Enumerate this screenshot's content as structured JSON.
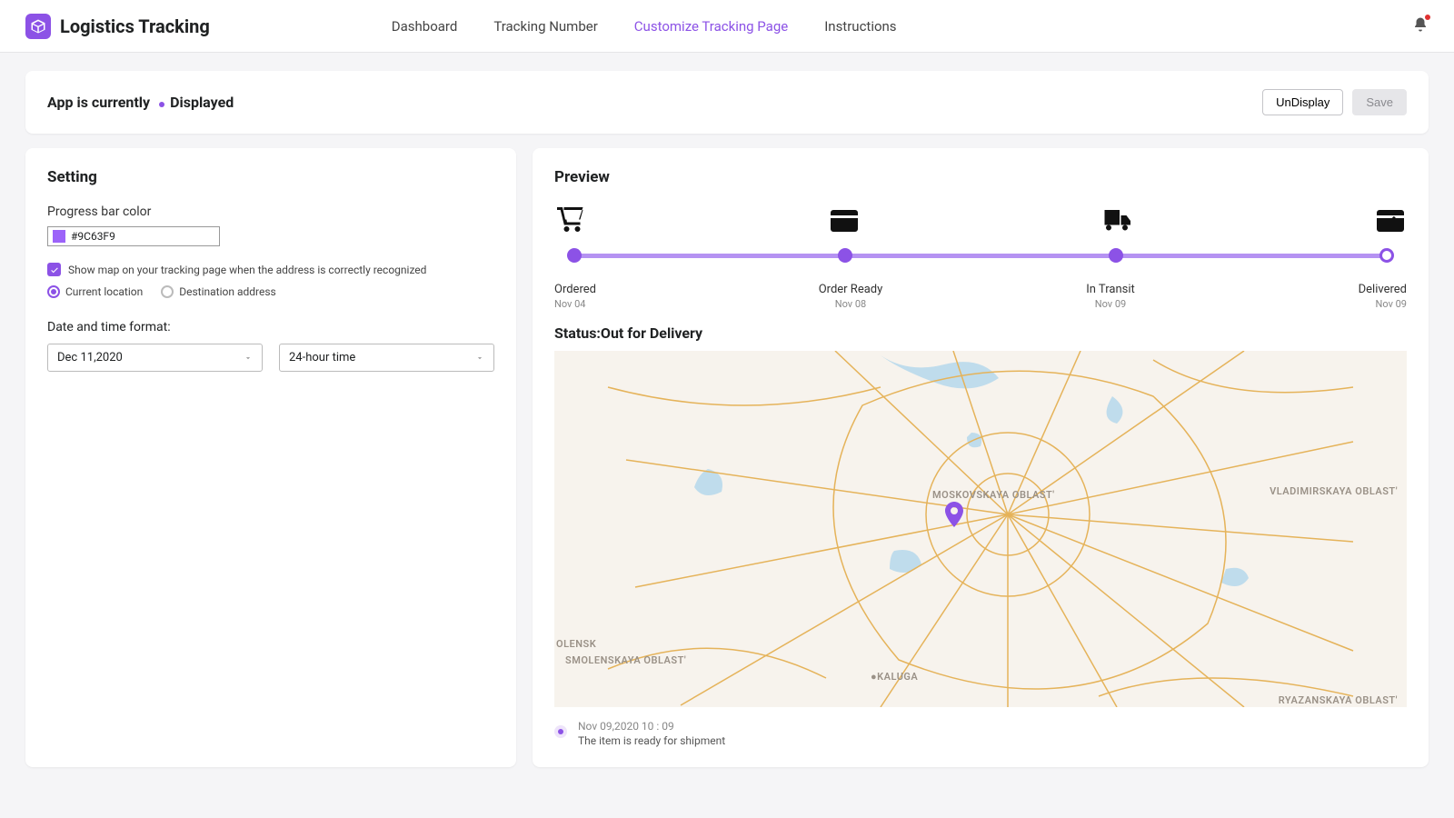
{
  "header": {
    "app_title": "Logistics Tracking",
    "nav": [
      {
        "label": "Dashboard",
        "active": false
      },
      {
        "label": "Tracking Number",
        "active": false
      },
      {
        "label": "Customize Tracking Page",
        "active": true
      },
      {
        "label": "Instructions",
        "active": false
      }
    ]
  },
  "status_bar": {
    "prefix": "App is currently",
    "value": "Displayed",
    "undisplay_btn": "UnDisplay",
    "save_btn": "Save"
  },
  "settings": {
    "title": "Setting",
    "progress_color_label": "Progress bar color",
    "progress_color_value": "#9C63F9",
    "checkbox_label": "Show map on your tracking page when the address is correctly recognized",
    "radio_current": "Current location",
    "radio_destination": "Destination address",
    "date_format_label": "Date and time format:",
    "date_select": "Dec 11,2020",
    "time_select": "24-hour time"
  },
  "preview": {
    "title": "Preview",
    "steps": [
      {
        "name": "Ordered",
        "date": "Nov 04"
      },
      {
        "name": "Order Ready",
        "date": "Nov 08"
      },
      {
        "name": "In Transit",
        "date": "Nov 09"
      },
      {
        "name": "Delivered",
        "date": "Nov 09"
      }
    ],
    "status_heading": "Status:Out for Delivery",
    "map_labels": {
      "moskovskaya": "MOSKOVSKAYA OBLAST'",
      "vladimirskaya": "VLADIMIRSKAYA OBLAST'",
      "olensk": "OLENSK",
      "smolenskaya": "SMOLENSKAYA OBLAST'",
      "kaluga": "●KALUGA",
      "ryazanskaya": "RYAZANSKAYA OBLAST'"
    },
    "timeline": {
      "time": "Nov 09,2020 10 : 09",
      "msg": "The item is ready for shipment"
    }
  },
  "colors": {
    "accent": "#8c52e6"
  }
}
